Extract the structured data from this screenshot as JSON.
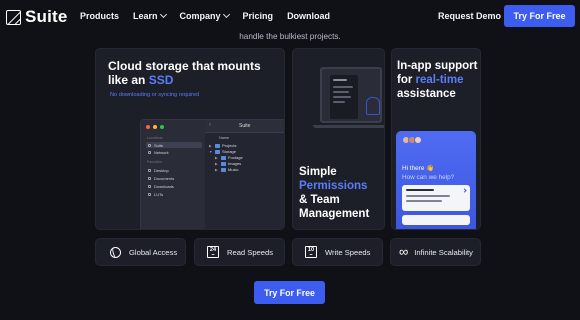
{
  "nav": {
    "logo": "Suite",
    "menu": [
      {
        "label": "Products",
        "has_dropdown": false
      },
      {
        "label": "Learn",
        "has_dropdown": true
      },
      {
        "label": "Company",
        "has_dropdown": true
      },
      {
        "label": "Pricing",
        "has_dropdown": false
      },
      {
        "label": "Download",
        "has_dropdown": false
      }
    ],
    "request_demo": "Request Demo",
    "cta": "Try For Free"
  },
  "tagline": "handle the bulkiest projects.",
  "card_storage": {
    "title_prefix": "Cloud storage that mounts like an ",
    "title_accent": "SSD",
    "subtitle": "No downloading or syncing required",
    "finder": {
      "title": "Suite",
      "sidebar_group_1": "Locations",
      "locations": [
        "Suite",
        "Network"
      ],
      "sidebar_group_2": "Favorites",
      "favorites": [
        "Desktop",
        "Documents",
        "Downloads",
        "LUTs"
      ],
      "column_header": "Name",
      "items": [
        "Projects",
        "Storage",
        "Footage",
        "Images",
        "Music"
      ]
    }
  },
  "card_permissions": {
    "line1": "Simple",
    "line2": "Permissions",
    "line3": "& Team",
    "line4": "Management"
  },
  "card_support": {
    "title_prefix": "In-app support for ",
    "title_accent": "real-time",
    "title_suffix": " assistance",
    "greeting": "Hi there 👋",
    "question": "How can we help?"
  },
  "features": [
    {
      "icon": "globe-icon",
      "label": "Global Access"
    },
    {
      "icon": "speed-24-icon",
      "badge": "24",
      "label": "Read Speeds"
    },
    {
      "icon": "speed-10-icon",
      "badge": "10",
      "label": "Write Speeds"
    },
    {
      "icon": "infinity-icon",
      "label": "Infinite Scalability"
    }
  ],
  "bottom_cta": "Try For Free",
  "colors": {
    "accent": "#3d5cf0",
    "accent_text": "#5b7cfa",
    "background": "#0f1117",
    "card": "#1d1f28"
  }
}
